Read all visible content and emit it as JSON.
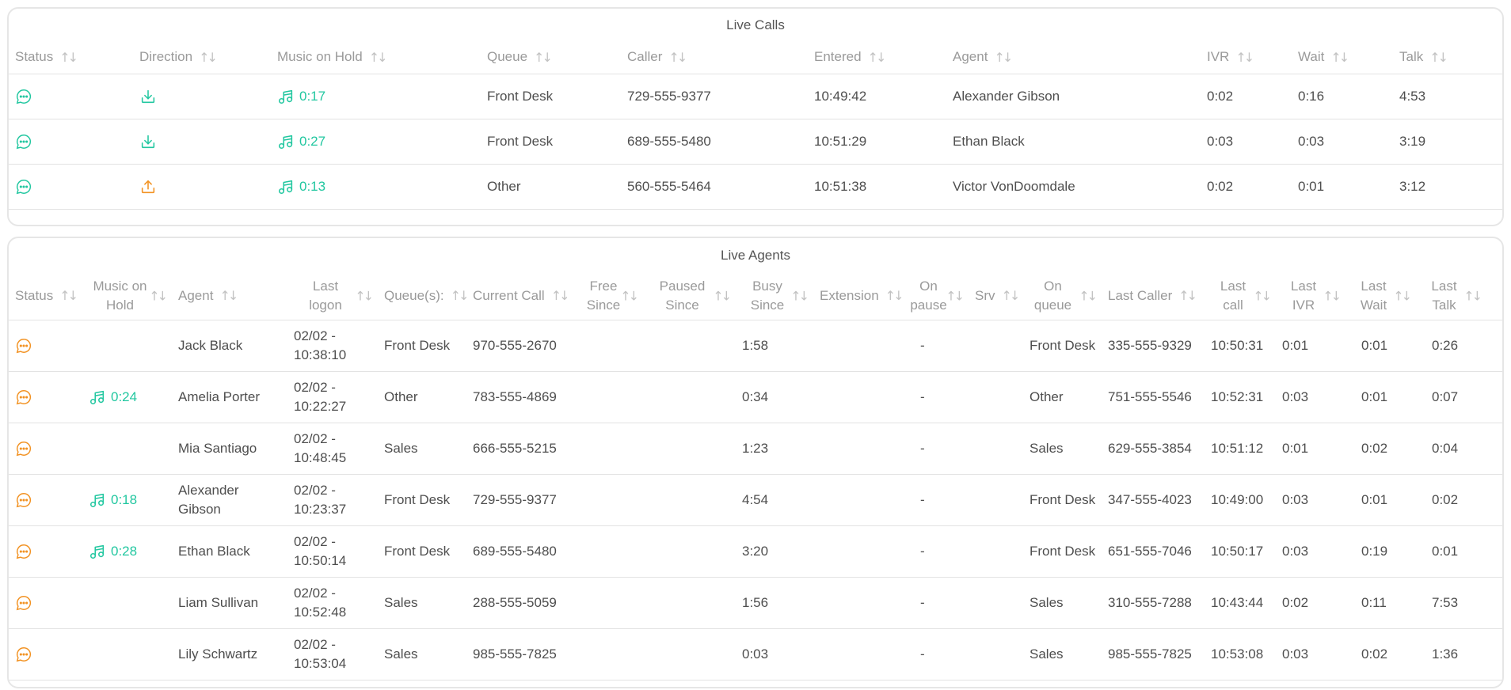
{
  "live_calls": {
    "title": "Live Calls",
    "columns": [
      "Status",
      "Direction",
      "Music on Hold",
      "Queue",
      "Caller",
      "Entered",
      "Agent",
      "IVR",
      "Wait",
      "Talk"
    ],
    "rows": [
      {
        "status_icon": "chat-bubble-icon",
        "direction_icon": "inbound-arrow-icon",
        "moh": "0:17",
        "queue": "Front Desk",
        "caller": "729-555-9377",
        "entered": "10:49:42",
        "agent": "Alexander Gibson",
        "ivr": "0:02",
        "wait": "0:16",
        "talk": "4:53"
      },
      {
        "status_icon": "chat-bubble-icon",
        "direction_icon": "inbound-arrow-icon",
        "moh": "0:27",
        "queue": "Front Desk",
        "caller": "689-555-5480",
        "entered": "10:51:29",
        "agent": "Ethan Black",
        "ivr": "0:03",
        "wait": "0:03",
        "talk": "3:19"
      },
      {
        "status_icon": "chat-bubble-icon",
        "direction_icon": "outbound-arrow-icon",
        "moh": "0:13",
        "queue": "Other",
        "caller": "560-555-5464",
        "entered": "10:51:38",
        "agent": "Victor VonDoomdale",
        "ivr": "0:02",
        "wait": "0:01",
        "talk": "3:12"
      }
    ]
  },
  "live_agents": {
    "title": "Live Agents",
    "columns": [
      "Status",
      "Music on Hold",
      "Agent",
      "Last logon",
      "Queue(s):",
      "Current Call",
      "Free Since",
      "Paused Since",
      "Busy Since",
      "Extension",
      "On pause",
      "Srv",
      "On queue",
      "Last Caller",
      "Last call",
      "Last IVR",
      "Last Wait",
      "Last Talk"
    ],
    "rows": [
      {
        "moh": "",
        "agent": "Jack Black",
        "logon_date": "02/02 -",
        "logon_time": "10:38:10",
        "queues": "Front Desk",
        "current_call": "970-555-2670",
        "busy_since": "1:58",
        "on_pause": "-",
        "on_queue": "Front Desk",
        "last_caller": "335-555-9329",
        "last_call": "10:50:31",
        "last_ivr": "0:01",
        "last_wait": "0:01",
        "last_talk": "0:26"
      },
      {
        "moh": "0:24",
        "agent": "Amelia Porter",
        "logon_date": "02/02 -",
        "logon_time": "10:22:27",
        "queues": "Other",
        "current_call": "783-555-4869",
        "busy_since": "0:34",
        "on_pause": "-",
        "on_queue": "Other",
        "last_caller": "751-555-5546",
        "last_call": "10:52:31",
        "last_ivr": "0:03",
        "last_wait": "0:01",
        "last_talk": "0:07"
      },
      {
        "moh": "",
        "agent": "Mia Santiago",
        "logon_date": "02/02 -",
        "logon_time": "10:48:45",
        "queues": "Sales",
        "current_call": "666-555-5215",
        "busy_since": "1:23",
        "on_pause": "-",
        "on_queue": "Sales",
        "last_caller": "629-555-3854",
        "last_call": "10:51:12",
        "last_ivr": "0:01",
        "last_wait": "0:02",
        "last_talk": "0:04"
      },
      {
        "moh": "0:18",
        "agent": "Alexander Gibson",
        "logon_date": "02/02 -",
        "logon_time": "10:23:37",
        "queues": "Front Desk",
        "current_call": "729-555-9377",
        "busy_since": "4:54",
        "on_pause": "-",
        "on_queue": "Front Desk",
        "last_caller": "347-555-4023",
        "last_call": "10:49:00",
        "last_ivr": "0:03",
        "last_wait": "0:01",
        "last_talk": "0:02"
      },
      {
        "moh": "0:28",
        "agent": "Ethan Black",
        "logon_date": "02/02 -",
        "logon_time": "10:50:14",
        "queues": "Front Desk",
        "current_call": "689-555-5480",
        "busy_since": "3:20",
        "on_pause": "-",
        "on_queue": "Front Desk",
        "last_caller": "651-555-7046",
        "last_call": "10:50:17",
        "last_ivr": "0:03",
        "last_wait": "0:19",
        "last_talk": "0:01"
      },
      {
        "moh": "",
        "agent": "Liam Sullivan",
        "logon_date": "02/02 -",
        "logon_time": "10:52:48",
        "queues": "Sales",
        "current_call": "288-555-5059",
        "busy_since": "1:56",
        "on_pause": "-",
        "on_queue": "Sales",
        "last_caller": "310-555-7288",
        "last_call": "10:43:44",
        "last_ivr": "0:02",
        "last_wait": "0:11",
        "last_talk": "7:53"
      },
      {
        "moh": "",
        "agent": "Lily Schwartz",
        "logon_date": "02/02 -",
        "logon_time": "10:53:04",
        "queues": "Sales",
        "current_call": "985-555-7825",
        "busy_since": "0:03",
        "on_pause": "-",
        "on_queue": "Sales",
        "last_caller": "985-555-7825",
        "last_call": "10:53:08",
        "last_ivr": "0:03",
        "last_wait": "0:02",
        "last_talk": "1:36"
      }
    ]
  },
  "colors": {
    "accent_green": "#22c7a0",
    "accent_orange": "#f29222",
    "border": "#e3e3e3",
    "header_text": "#9a9a9a"
  },
  "icons": {
    "sort": "sort-arrows-icon",
    "music": "music-note-icon",
    "status": "chat-bubble-icon"
  }
}
